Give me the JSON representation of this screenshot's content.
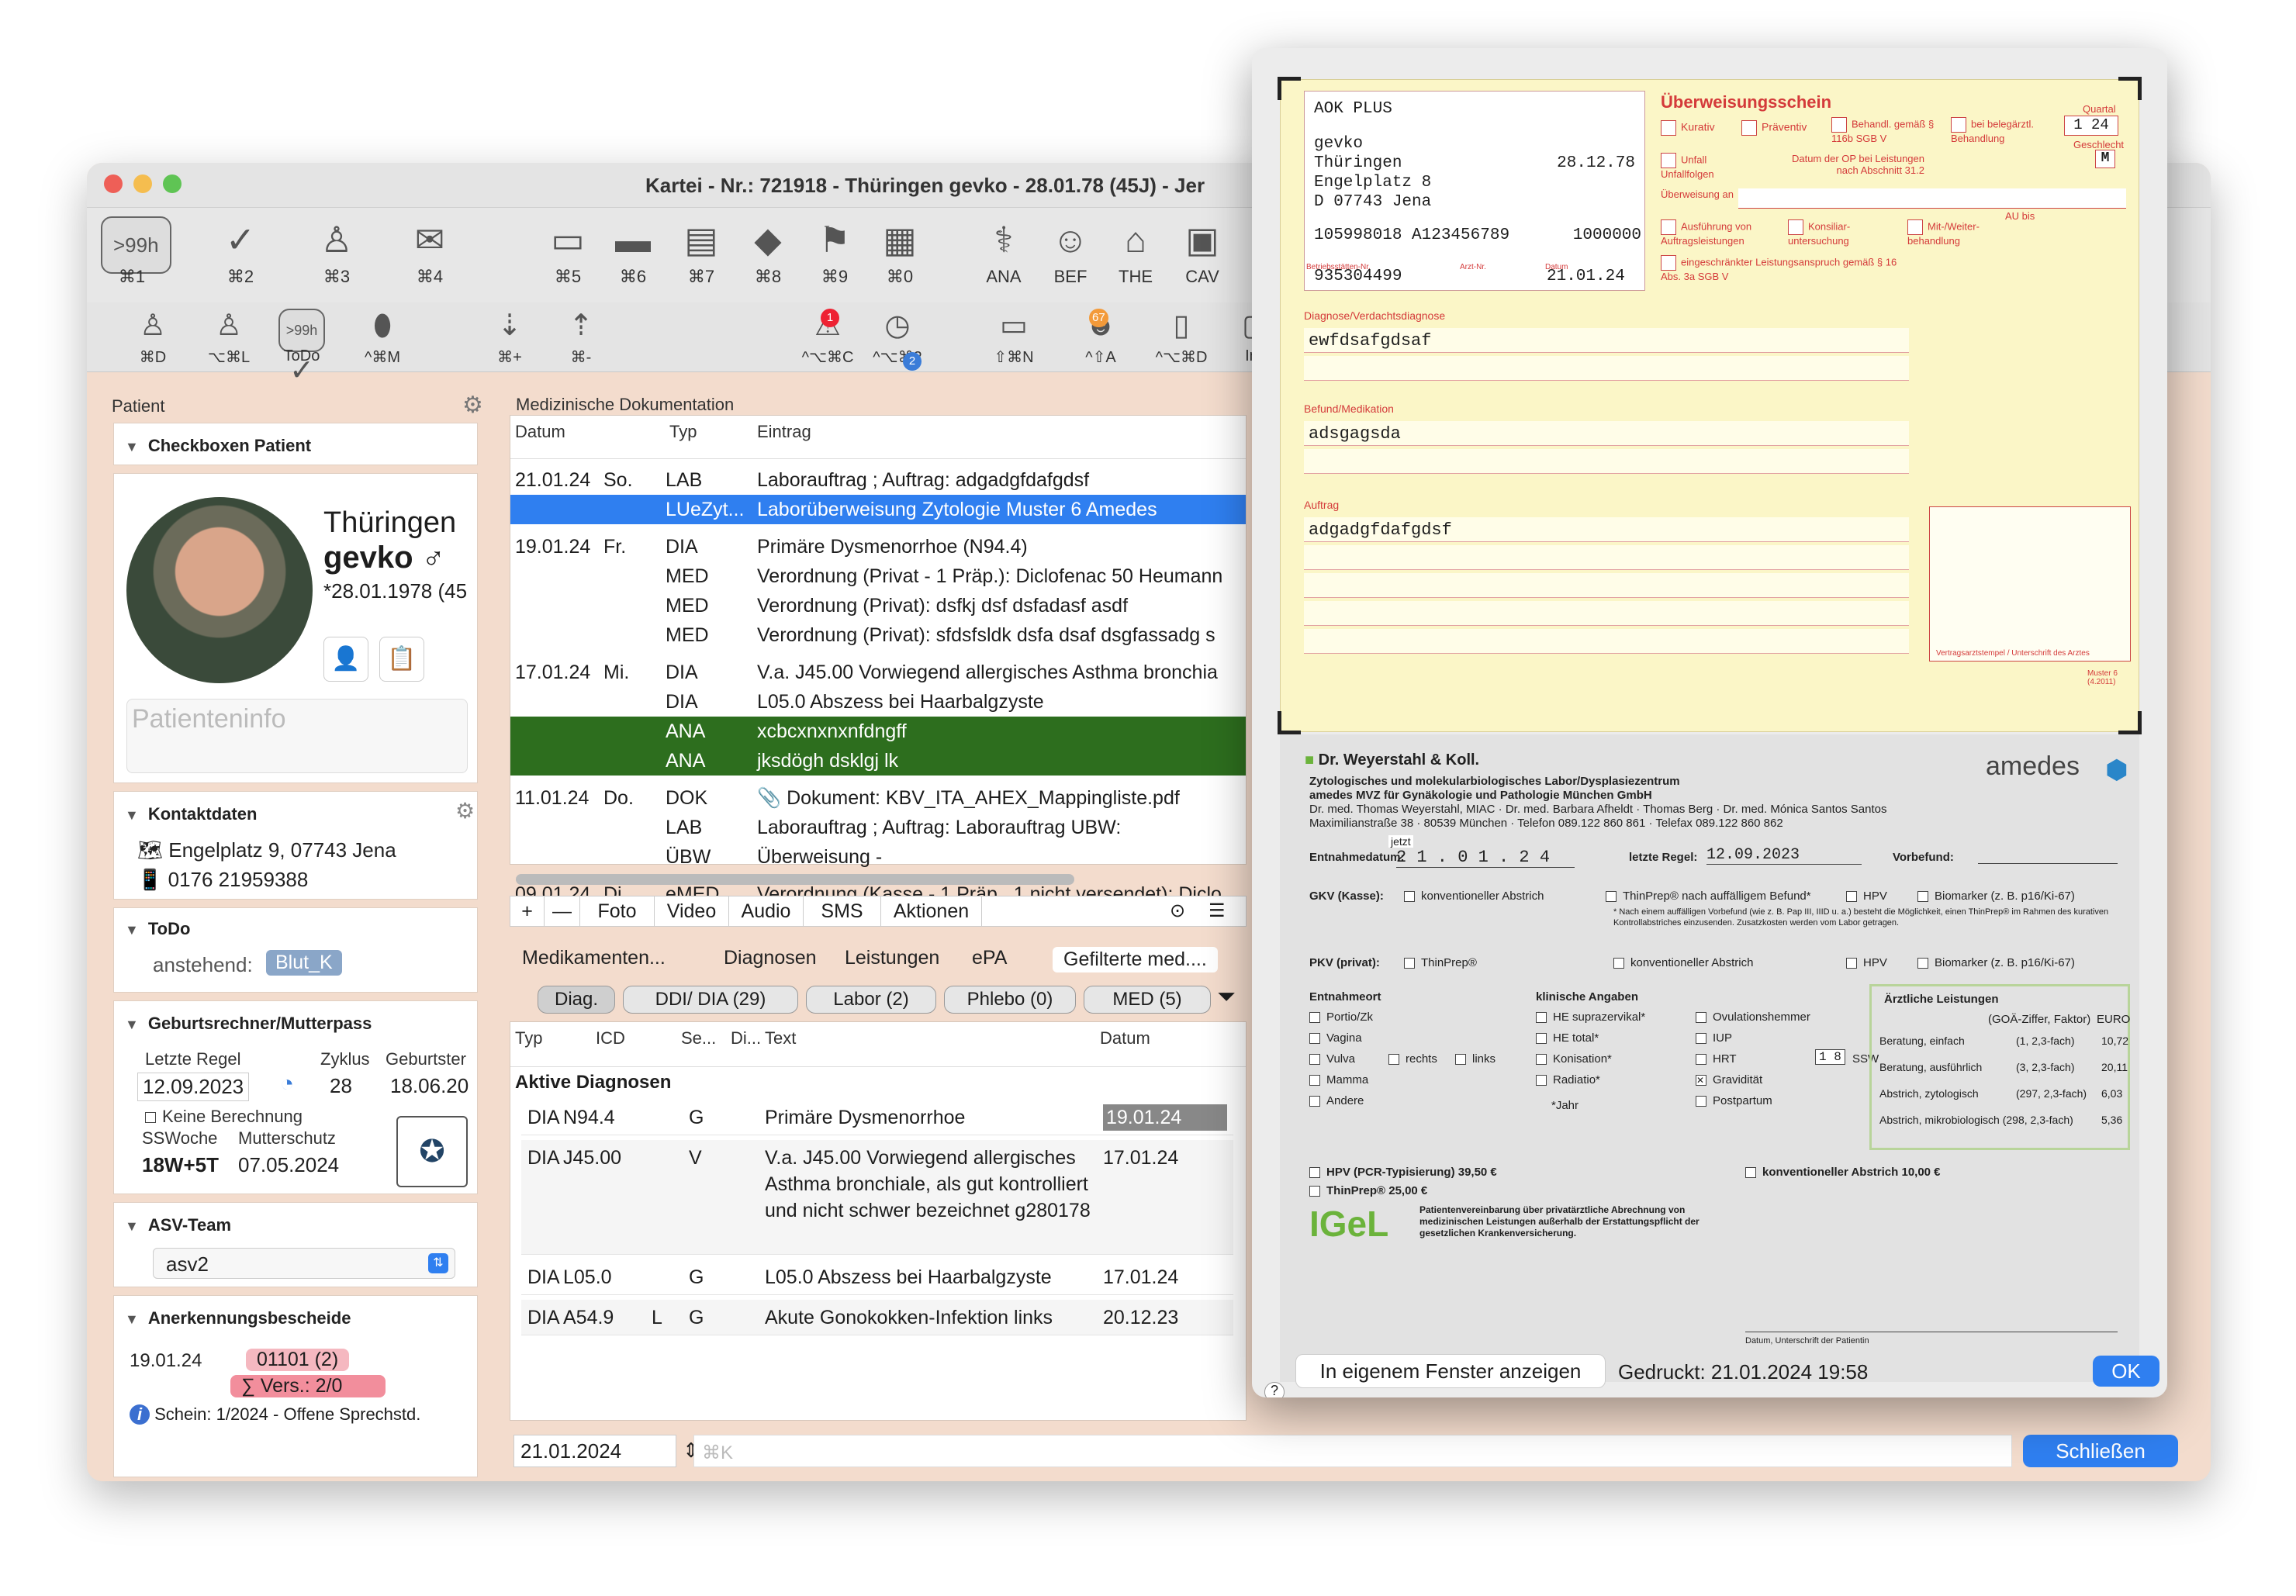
{
  "window": {
    "title": "Kartei - Nr.: 721918 - Thüringen gevko - 28.01.78 (45J) - Jer"
  },
  "toolbar1": [
    {
      "name": ">99h",
      "key": "⌘1",
      "icon": "history-icon"
    },
    {
      "name": "",
      "key": "⌘2",
      "icon": "check-icon"
    },
    {
      "name": "",
      "key": "⌘3",
      "icon": "person-icon"
    },
    {
      "name": "",
      "key": "⌘4",
      "icon": "mail-add-icon"
    },
    {
      "name": "",
      "key": "⌘5",
      "icon": "card-icon"
    },
    {
      "name": "",
      "key": "⌘6",
      "icon": "card-green-icon"
    },
    {
      "name": "",
      "key": "⌘7",
      "icon": "au-doc-icon"
    },
    {
      "name": "",
      "key": "⌘8",
      "icon": "cube-icon"
    },
    {
      "name": "",
      "key": "⌘9",
      "icon": "run-icon"
    },
    {
      "name": "",
      "key": "⌘0",
      "icon": "hospital-icon"
    },
    {
      "name": "",
      "key": "ANA",
      "icon": "stethoscope-icon"
    },
    {
      "name": "",
      "key": "BEF",
      "icon": "doctor-icon"
    },
    {
      "name": "",
      "key": "THE",
      "icon": "bed-icon"
    },
    {
      "name": "",
      "key": "CAV",
      "icon": "clipboard-icon"
    }
  ],
  "toolbar2": [
    {
      "key": "⌘D",
      "icon": "person-icon"
    },
    {
      "key": "⌥⌘L",
      "icon": "person-add-icon"
    },
    {
      "key": "ToDo",
      "icon": "todo-icon"
    },
    {
      "key": "^⌘M",
      "icon": "pills-icon"
    },
    {
      "key": "⌘+",
      "icon": "sort-down-icon"
    },
    {
      "key": "⌘-",
      "icon": "sort-up-icon"
    },
    {
      "key": "^⌥⌘C",
      "icon": "alarm-icon"
    },
    {
      "key": "^⌥⌘2",
      "icon": "clock-icon"
    },
    {
      "key": "⇧⌘N",
      "icon": "chat-icon"
    },
    {
      "key": "^⇧A",
      "icon": "patient-icon"
    },
    {
      "key": "^⌥⌘D",
      "icon": "book-icon"
    },
    {
      "key": "Inb",
      "icon": "inbox-icon"
    }
  ],
  "toolbar2_badges": {
    "alarm": "1",
    "clock": "2",
    "patient": "67"
  },
  "toolbar2_pill": ">99h",
  "sidebar": {
    "header": "Patient",
    "checkboxen_title": "Checkboxen Patient",
    "last_name": "Thüringen",
    "first_name": "gevko ♂",
    "birth": "*28.01.1978 (45",
    "patienteninfo": "Patienteninfo",
    "kontakt_title": "Kontaktdaten",
    "address": "Engelplatz 9, 07743 Jena",
    "phone": "0176 21959388",
    "todo_title": "ToDo",
    "todo_label": "anstehend:",
    "todo_chip": "Blut_K",
    "geburt_title": "Geburtsrechner/Mutterpass",
    "letzte_regel_label": "Letzte Regel",
    "zyklus_label": "Zyklus",
    "geburtster_label": "Geburtster",
    "letzte_regel": "12.09.2023",
    "zyklus": "28",
    "geburtster": "18.06.20",
    "keine_berechnung": "Keine Berechnung",
    "ssw_label": "SSWoche",
    "mutterschutz_label": "Mutterschutz",
    "ssw": "18W+5T",
    "mutterschutz": "07.05.2024",
    "asv_title": "ASV-Team",
    "asv_value": "asv2",
    "anerk_title": "Anerkennungsbescheide",
    "anerk_date": "19.01.24",
    "anerk_code": "01101 (2)",
    "anerk_sum": "∑ Vers.: 2/0",
    "schein": "Schein: 1/2024 - Offene Sprechstd."
  },
  "meddoc": {
    "title": "Medizinische Dokumentation",
    "columns": [
      "Datum",
      "Typ",
      "Eintrag"
    ],
    "rows": [
      {
        "date": "21.01.24",
        "day": "So.",
        "type": "LAB",
        "text": "Laborauftrag ; Auftrag: adgadgfdafgdsf",
        "style": ""
      },
      {
        "date": "",
        "day": "",
        "type": "LUeZyt...",
        "text": "Laborüberweisung Zytologie Muster 6 Amedes",
        "style": "sel"
      },
      {
        "date": "19.01.24",
        "day": "Fr.",
        "type": "DIA",
        "text": "Primäre Dysmenorrhoe (N94.4)",
        "style": ""
      },
      {
        "date": "",
        "day": "",
        "type": "MED",
        "text": "Verordnung (Privat - 1 Präp.): Diclofenac 50 Heumann",
        "style": ""
      },
      {
        "date": "",
        "day": "",
        "type": "MED",
        "text": "Verordnung (Privat): dsfkj dsf dsfadasf asdf",
        "style": ""
      },
      {
        "date": "",
        "day": "",
        "type": "MED",
        "text": "Verordnung (Privat): sfdsfsldk dsfa dsaf dsgfassadg  s",
        "style": ""
      },
      {
        "date": "17.01.24",
        "day": "Mi.",
        "type": "DIA",
        "text": "V.a. J45.00 Vorwiegend allergisches Asthma bronchia",
        "style": ""
      },
      {
        "date": "",
        "day": "",
        "type": "DIA",
        "text": "L05.0 Abszess bei Haarbalgzyste",
        "style": ""
      },
      {
        "date": "",
        "day": "",
        "type": "ANA",
        "text": "xcbcxnxnxnfdngff",
        "style": "grn"
      },
      {
        "date": "",
        "day": "",
        "type": "ANA",
        "text": "jksdögh dsklgj lk",
        "style": "grn"
      },
      {
        "date": "11.01.24",
        "day": "Do.",
        "type": "DOK",
        "text": "📎 Dokument: KBV_ITA_AHEX_Mappingliste.pdf",
        "style": ""
      },
      {
        "date": "",
        "day": "",
        "type": "LAB",
        "text": "Laborauftrag ; Auftrag: Laborauftrag UBW:",
        "style": ""
      },
      {
        "date": "",
        "day": "",
        "type": "ÜBW",
        "text": "Überweisung -",
        "style": ""
      },
      {
        "date": "09.01.24",
        "day": "Di.",
        "type": "eMED",
        "text": "Verordnung (Kasse - 1 Präp., 1 nicht versendet): Diclo",
        "style": ""
      }
    ],
    "buttons": [
      "+",
      "—",
      "Foto",
      "Video",
      "Audio",
      "SMS",
      "Aktionen"
    ]
  },
  "lower": {
    "tabs": [
      "Medikamenten...",
      "Diagnosen",
      "Leistungen",
      "ePA",
      "Gefilterte med...."
    ],
    "chips": [
      "Diag.",
      "DDI/ DIA (29)",
      "Labor (2)",
      "Phlebo (0)",
      "MED (5)"
    ],
    "columns": [
      "Typ",
      "ICD",
      "Se...",
      "Di...",
      "Text",
      "Datum"
    ],
    "group": "Aktive Diagnosen",
    "rows": [
      {
        "typ": "DIA",
        "icd": "N94.4",
        "se": "",
        "di": "G",
        "text": "Primäre Dysmenorrhoe",
        "datum": "19.01.24",
        "lines": 1
      },
      {
        "typ": "DIA",
        "icd": "J45.00",
        "se": "",
        "di": "V",
        "text": "V.a. J45.00 Vorwiegend allergisches Asthma bronchiale, als gut kontrolliert und nicht schwer bezeichnet g280178",
        "datum": "17.01.24",
        "lines": 4
      },
      {
        "typ": "DIA",
        "icd": "L05.0",
        "se": "",
        "di": "G",
        "text": "L05.0 Abszess bei Haarbalgzyste",
        "datum": "17.01.24",
        "lines": 1
      },
      {
        "typ": "DIA",
        "icd": "A54.9",
        "se": "L",
        "di": "G",
        "text": "Akute Gonokokken-Infektion links",
        "datum": "20.12.23",
        "lines": 1
      }
    ]
  },
  "bottom": {
    "date": "21.01.2024",
    "placeholder": "⌘K",
    "close": "Schließen"
  },
  "dialog": {
    "form": {
      "kasse": "AOK PLUS",
      "name1": "gevko",
      "name2": "Thüringen",
      "geb": "28.12.78",
      "street": "Engelplatz 8",
      "city": "D 07743 Jena",
      "ids": "105998018 A123456789",
      "status": "1000000",
      "bsnr_label": "Betriebsstätten-Nr.",
      "lanr_label": "Arzt-Nr.",
      "datum_label": "Datum",
      "bsnr": "935304499",
      "datum": "21.01.24",
      "title": "Überweisungsschein",
      "quartal_label": "Quartal",
      "quartal": "1 24",
      "geschlecht_label": "Geschlecht",
      "geschlecht": "M",
      "kurativ": "Kurativ",
      "praeventiv": "Präventiv",
      "behandl": "Behandl. gemäß § 116b SGB V",
      "beleg": "bei belegärztl. Behandlung",
      "unfall": "Unfall Unfallfolgen",
      "op_label": "Datum der OP bei Leistungen nach Abschnitt 31.2",
      "ueberweisung_an": "Überweisung an",
      "ausfuehrung": "Ausführung von Auftragsleistungen",
      "konsiliar": "Konsiliar- untersuchung",
      "mitweiter": "Mit-/Weiter- behandlung",
      "au_bis": "AU bis",
      "eingeschraenkt": "eingeschränkter Leistungsanspruch gemäß § 16 Abs. 3a SGB V",
      "diag_label": "Diagnose/Verdachtsdiagnose",
      "diag": "ewfdsafgdsaf",
      "befund_label": "Befund/Medikation",
      "befund": "adsgagsda",
      "auftrag_label": "Auftrag",
      "auftrag": "adgadgfdafgdsf",
      "stempel": "Vertragsarztstempel / Unterschrift des Arztes",
      "muster": "Muster 6 (4.2011)"
    },
    "amedes": {
      "head": "Dr. Weyerstahl & Koll.",
      "sub1": "Zytologisches und molekularbiologisches Labor/Dysplasiezentrum",
      "sub2": "amedes MVZ für Gynäkologie und Pathologie München GmbH",
      "sub3": "Dr. med. Thomas Weyerstahl, MIAC · Dr. med. Barbara Afheldt · Thomas Berg · Dr. med. Mónica Santos Santos",
      "sub4": "Maximilianstraße 38 · 80539 München · Telefon 089.122 860 861 · Telefax 089.122 860 862",
      "logo": "amedes",
      "entnahme_label": "Entnahmedatum:",
      "jetzt": "jetzt",
      "entnahme": "2 1 . 0 1 . 2 4",
      "regel_label": "letzte Regel:",
      "regel": "12.09.2023",
      "vorbefund_label": "Vorbefund:",
      "gkv": "GKV (Kasse):",
      "konv": "konventioneller Abstrich",
      "thinprep_n": "ThinPrep® nach auffälligem Befund*",
      "hpv": "HPV",
      "biomarker": "Biomarker (z. B. p16/Ki-67)",
      "note": "* Nach einem auffälligen Vorbefund (wie z. B. Pap III, IIID u. a.) besteht die Möglichkeit, einen ThinPrep® im Rahmen des kurativen Kontrollabstriches einzusenden. Zusatzkosten werden vom Labor getragen.",
      "pkv": "PKV (privat):",
      "thinprep": "ThinPrep®",
      "entnahmeort": "Entnahmeort",
      "orte": [
        "Portio/Zk",
        "Vagina",
        "Vulva",
        "Mamma",
        "Andere"
      ],
      "rechts": "rechts",
      "links": "links",
      "klinisch": "klinische Angaben",
      "klin_left": [
        "HE suprazervikal*",
        "HE total*",
        "Konisation*",
        "Radiatio*"
      ],
      "jahr": "*Jahr",
      "klin_right": [
        "Ovulationshemmer",
        "IUP",
        "HRT",
        "Gravidität",
        "Postpartum"
      ],
      "ssw_vals": "1 8",
      "ssw_unit": "SSW",
      "aerztlich": "Ärztliche Leistungen",
      "goae_head": "(GOÄ-Ziffer, Faktor)",
      "euro": "EURO",
      "leist": [
        {
          "t": "Beratung, einfach",
          "g": "(1, 2,3-fach)",
          "e": "10,72"
        },
        {
          "t": "Beratung, ausführlich",
          "g": "(3, 2,3-fach)",
          "e": "20,11"
        },
        {
          "t": "Abstrich, zytologisch",
          "g": "(297, 2,3-fach)",
          "e": "6,03"
        },
        {
          "t": "Abstrich, mikrobiologisch (298, 2,3-fach)",
          "g": "",
          "e": "5,36"
        }
      ],
      "hpv_pcr": "HPV (PCR-Typisierung) 39,50 €",
      "thinprep_p": "ThinPrep® 25,00 €",
      "konv_p": "konventioneller Abstrich 10,00 €",
      "igel": "IGeL",
      "igel_t": "Patientenvereinbarung über privatärztliche Abrechnung von medizinischen Leistungen außerhalb der Erstattungspflicht der gesetzlichen Krankenversicherung.",
      "unterschrift": "Datum, Unterschrift der Patientin"
    },
    "show_own": "In eigenem Fenster anzeigen",
    "printed": "Gedruckt: 21.01.2024 19:58",
    "ok": "OK",
    "help": "?"
  },
  "colors": {
    "accent": "#2f7ff0",
    "green": "#2d6e1e",
    "form": "#fbf6c7",
    "formred": "#d43a3a"
  }
}
